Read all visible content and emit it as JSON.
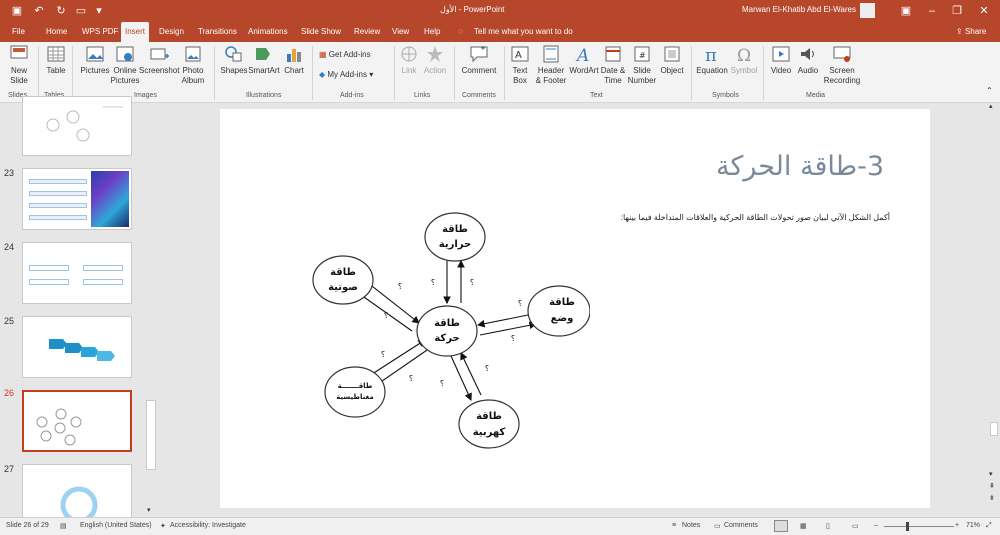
{
  "titlebar": {
    "doc_title": "الأول  -  PowerPoint",
    "user_name": "Marwan El-Khatib Abd El-Wares"
  },
  "tabs": [
    "File",
    "Home",
    "WPS PDF",
    "Insert",
    "Design",
    "Transitions",
    "Animations",
    "Slide Show",
    "Review",
    "View",
    "Help"
  ],
  "tell_me": "Tell me what you want to do",
  "share": "Share",
  "ribbon": {
    "new_slide": [
      "New",
      "Slide"
    ],
    "table": "Table",
    "pictures": "Pictures",
    "online_pictures": [
      "Online",
      "Pictures"
    ],
    "screenshot": "Screenshot",
    "photo_album": [
      "Photo",
      "Album"
    ],
    "shapes": "Shapes",
    "smartart": "SmartArt",
    "chart": "Chart",
    "get_addins": "Get Add-ins",
    "my_addins": "My Add-ins",
    "link": "Link",
    "action": "Action",
    "comment": "Comment",
    "text_box": [
      "Text",
      "Box"
    ],
    "header_footer": [
      "Header",
      "& Footer"
    ],
    "wordart": "WordArt",
    "date_time": [
      "Date &",
      "Time"
    ],
    "slide_number": [
      "Slide",
      "Number"
    ],
    "object": "Object",
    "equation": "Equation",
    "symbol": "Symbol",
    "video": "Video",
    "audio": "Audio",
    "screen_recording": [
      "Screen",
      "Recording"
    ],
    "groups": [
      "Slides",
      "Tables",
      "Images",
      "Illustrations",
      "Add-ins",
      "Links",
      "Comments",
      "Text",
      "Symbols",
      "Media"
    ]
  },
  "thumbnails": [
    {
      "num": "23"
    },
    {
      "num": "24"
    },
    {
      "num": "25"
    },
    {
      "num": "26"
    },
    {
      "num": "27"
    }
  ],
  "slide": {
    "title": "3-طاقة الحركة",
    "instruction": "أكمل الشكل الآتي لبيان صور تحولات الطاقة الحركية والعلاقات المتداخلة فيما بينها:",
    "diagram": {
      "center": [
        "طاقة",
        "حركة"
      ],
      "nodes": [
        {
          "id": "thermal",
          "lines": [
            "طاقة",
            "حرارية"
          ]
        },
        {
          "id": "sound",
          "lines": [
            "طاقة",
            "صوتية"
          ]
        },
        {
          "id": "potential",
          "lines": [
            "طاقة",
            "وضع"
          ]
        },
        {
          "id": "magnetic",
          "lines": [
            "طاقـــــــة",
            "مغناطيسية"
          ]
        },
        {
          "id": "electric",
          "lines": [
            "طاقة",
            "كهربية"
          ]
        }
      ],
      "blank_mark": "؟"
    }
  },
  "status": {
    "slide_of": "Slide 26 of 29",
    "language": "English (United States)",
    "accessibility": "Accessibility: Investigate",
    "notes": "Notes",
    "comments": "Comments",
    "zoom": "71%"
  },
  "colors": {
    "accent": "#b7472a",
    "title_gray": "#7a8a9a"
  }
}
